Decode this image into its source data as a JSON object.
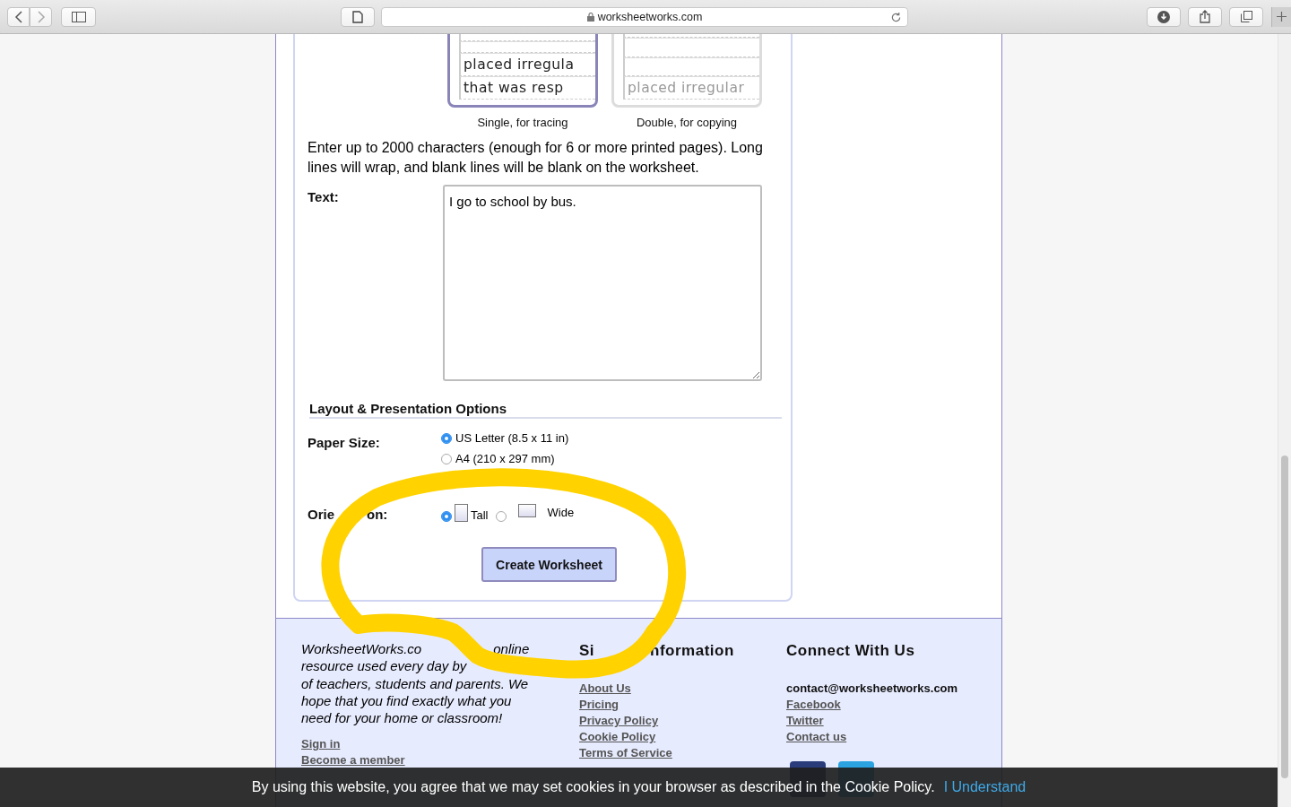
{
  "browser": {
    "url": "worksheetworks.com"
  },
  "styles": [
    {
      "caption": "Single, for tracing",
      "selected": true,
      "lines": [
        "placed irregula",
        "that was resp"
      ]
    },
    {
      "caption": "Double, for copying",
      "selected": false,
      "lines": [
        "placed irregular"
      ]
    }
  ],
  "intro": "Enter up to 2000 characters (enough for 6 or more printed pages). Long lines will wrap, and blank lines will be blank on the worksheet.",
  "text_field": {
    "label": "Text:",
    "value": "I go to school by bus. "
  },
  "section_title": "Layout & Presentation Options",
  "paper_size": {
    "label": "Paper Size:",
    "options": [
      {
        "label": "US Letter (8.5 x 11 in)",
        "selected": true
      },
      {
        "label": "A4 (210 x 297 mm)",
        "selected": false
      }
    ]
  },
  "orientation": {
    "label_parts": [
      "Orie",
      "on:"
    ],
    "options": [
      {
        "label": "Tall",
        "kind": "tall",
        "selected": true
      },
      {
        "label": "Wide",
        "kind": "wide",
        "selected": false
      }
    ]
  },
  "create_button": "Create Worksheet",
  "footer": {
    "about_lines": [
      [
        "WorksheetWorks.co",
        "online"
      ],
      [
        "resource used every day by"
      ],
      [
        "of teachers, students and parents. We"
      ],
      [
        "hope that you find exactly what you"
      ],
      [
        "need for your home or classroom!"
      ]
    ],
    "account_links": [
      "Sign in",
      "Become a member"
    ],
    "site_heading_parts": [
      "Si",
      "nformation"
    ],
    "site_links": [
      "About Us",
      "Pricing",
      "Privacy Policy",
      "Cookie Policy",
      "Terms of Service"
    ],
    "connect_heading": "Connect With Us",
    "email": "contact@worksheetworks.com",
    "connect_links": [
      "Facebook",
      "Twitter",
      "Contact us"
    ]
  },
  "cookie_bar": {
    "message": "By using this website, you agree that we may set cookies in your browser as described in the Cookie Policy.",
    "button": "I Understand"
  }
}
